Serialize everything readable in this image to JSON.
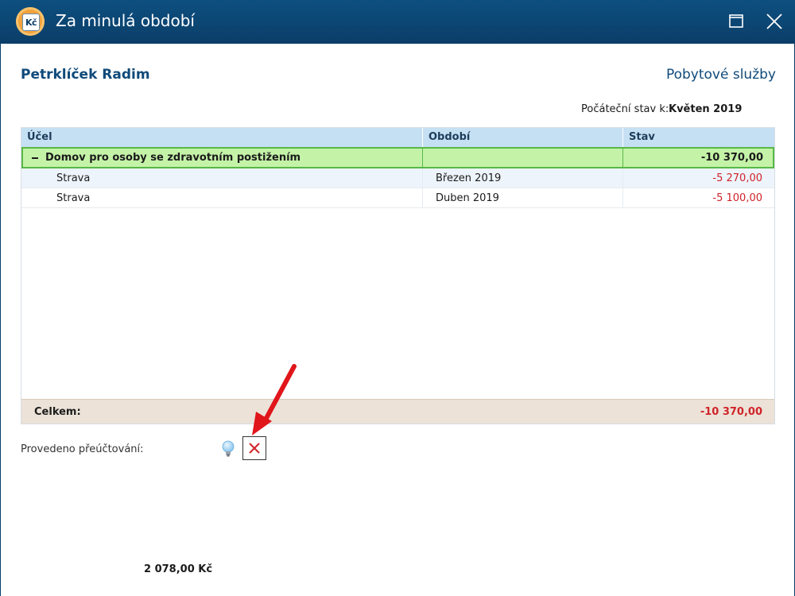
{
  "window": {
    "title": "Za minulá období",
    "app_icon_text": "Kč"
  },
  "header": {
    "client_name": "Petrklíček Radim",
    "service_type": "Pobytové služby",
    "initial_state_label": "Počáteční stav k:",
    "initial_state_value": "Květen 2019"
  },
  "grid": {
    "columns": [
      "Účel",
      "Období",
      "Stav"
    ],
    "group": {
      "label": "Domov pro osoby se zdravotním postižením",
      "total": "-10 370,00"
    },
    "rows": [
      {
        "purpose": "Strava",
        "period": "Březen 2019",
        "state": "-5 270,00"
      },
      {
        "purpose": "Strava",
        "period": "Duben 2019",
        "state": "-5 100,00"
      }
    ],
    "footer": {
      "label": "Celkem:",
      "total": "-10 370,00"
    }
  },
  "rebilling": {
    "label": "Provedeno přeúčtování:",
    "status_icon": "x-mark-icon"
  },
  "bottom_amount": "2 078,00 Kč",
  "colors": {
    "titlebar": "#0b3e68",
    "accent_text": "#0f4a7a",
    "header_row": "#c6e0f3",
    "group_row": "#c4f3a8",
    "group_border": "#58b846",
    "negative": "#d0242a",
    "footer": "#ece2d7",
    "arrow": "#e0161b"
  }
}
